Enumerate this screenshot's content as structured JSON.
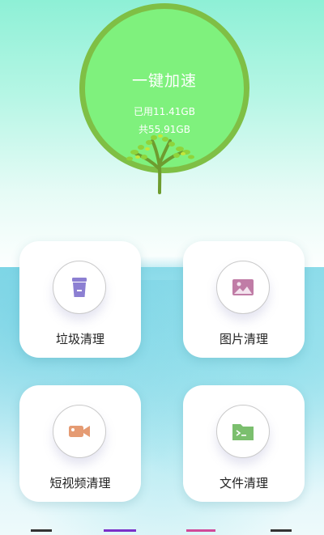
{
  "boost": {
    "title": "一键加速",
    "used": "已用11.41GB",
    "total": "共55.91GB",
    "ring_color": "#7fbf45",
    "fill_color": "#7ff17d"
  },
  "cards": [
    {
      "label": "垃圾清理",
      "icon": "trash-icon",
      "color": "#8c7fd2"
    },
    {
      "label": "图片清理",
      "icon": "image-icon",
      "color": "#c07ca6"
    },
    {
      "label": "短视频清理",
      "icon": "video-camera-icon",
      "color": "#e59b73"
    },
    {
      "label": "文件清理",
      "icon": "folder-terminal-icon",
      "color": "#7bbf6e"
    }
  ],
  "nav": {
    "colors": [
      "#333333",
      "#7a30c8",
      "#d04a9a",
      "#333333"
    ]
  }
}
